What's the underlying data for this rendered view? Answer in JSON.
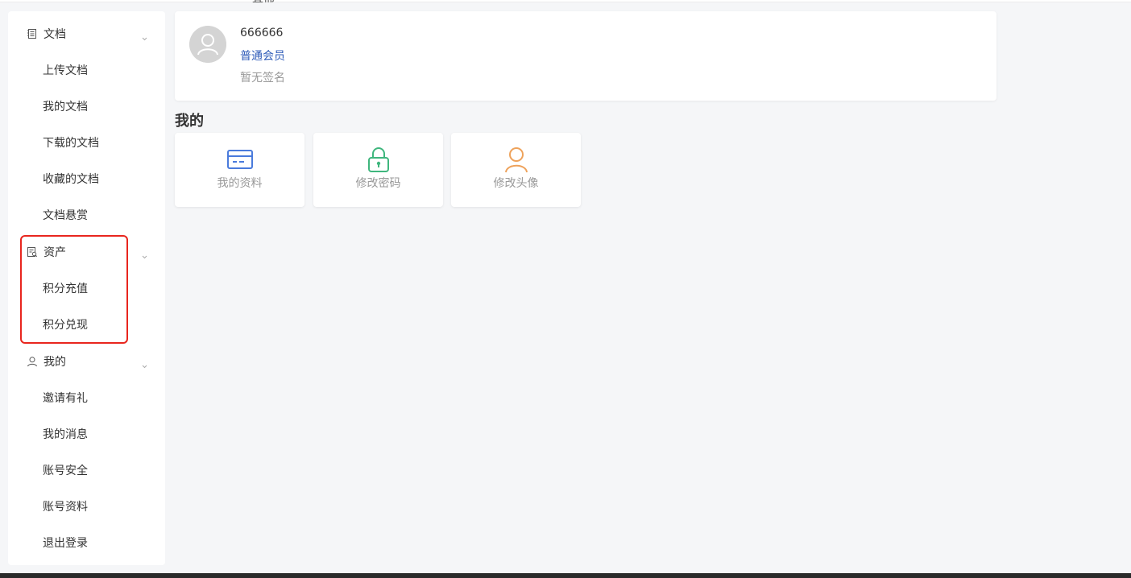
{
  "header": {
    "cut_text": "其他"
  },
  "sidebar": {
    "groups": [
      {
        "label": "文档",
        "icon": "document-list-icon",
        "items": [
          "上传文档",
          "我的文档",
          "下载的文档",
          "收藏的文档",
          "文档悬赏"
        ]
      },
      {
        "label": "资产",
        "icon": "asset-icon",
        "items": [
          "积分充值",
          "积分兑现"
        ]
      },
      {
        "label": "我的",
        "icon": "user-icon",
        "items": [
          "邀请有礼",
          "我的消息",
          "账号安全",
          "账号资料",
          "退出登录"
        ]
      }
    ]
  },
  "profile": {
    "username": "666666",
    "member_level": "普通会员",
    "signature": "暂无签名"
  },
  "section": {
    "title": "我的"
  },
  "quick_actions": [
    {
      "label": "我的资料",
      "icon": "card-icon",
      "color": "#4a7bdc"
    },
    {
      "label": "修改密码",
      "icon": "lock-icon",
      "color": "#3fb67d"
    },
    {
      "label": "修改头像",
      "icon": "user-avatar-icon",
      "color": "#eea25b"
    }
  ],
  "colors": {
    "highlight": "#e8261e",
    "member": "#2e5bb8"
  }
}
